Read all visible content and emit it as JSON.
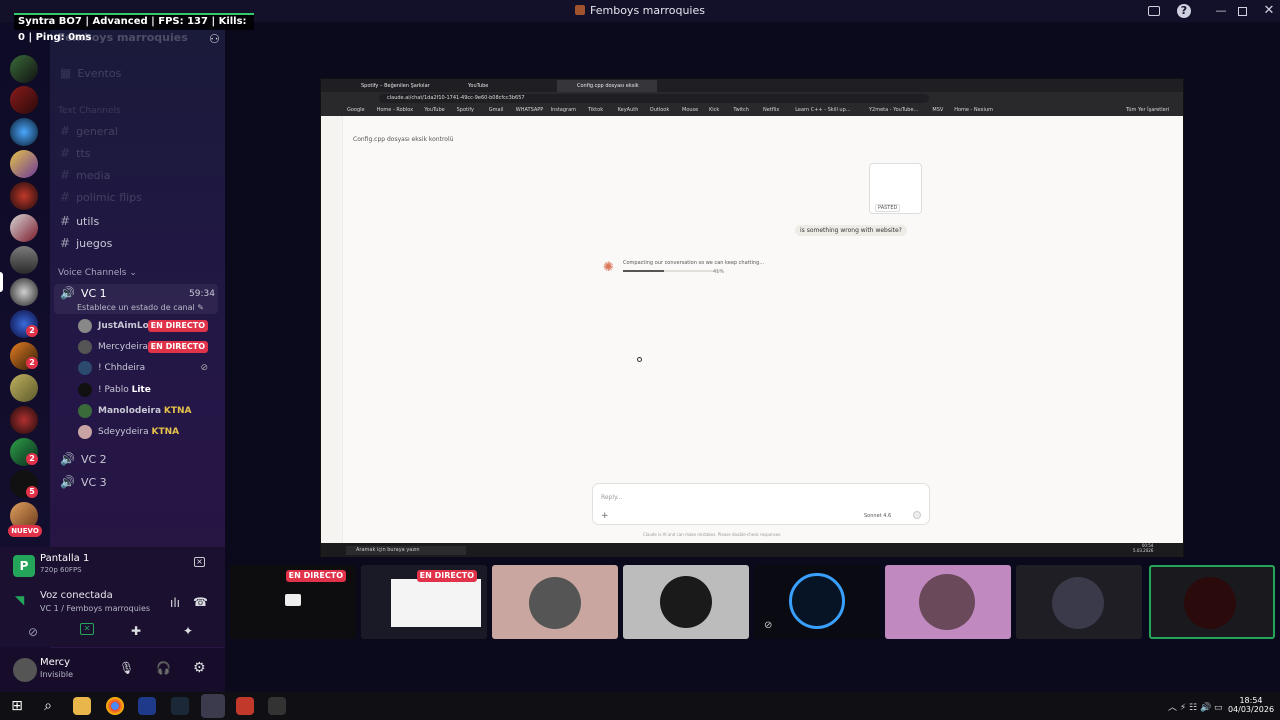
{
  "window": {
    "title": "Femboys marroquies"
  },
  "overlay": {
    "text": "Syntra BO7 | Advanced | FPS: 137 | Kills: 0 | Ping: 0ms"
  },
  "server": {
    "name": "Femboys marroquies"
  },
  "channels_faded": {
    "events": "Eventos",
    "text_cat": "Text Channels",
    "items": [
      "general",
      "tts",
      "media",
      "polimic flips"
    ]
  },
  "channels": {
    "text": [
      "utils",
      "juegos"
    ],
    "voice_cat": "Voice Channels",
    "vc1": "VC 1",
    "vc1_time": "59:34",
    "vc1_status": "Establece un estado de canal",
    "vc2": "VC 2",
    "vc3": "VC 3"
  },
  "voice_users": [
    {
      "name": "JustAimLock",
      "tag": "EN DIRECTO"
    },
    {
      "name": "Mercydeira",
      "tag": "EN DIRECTO"
    },
    {
      "name": "! Chhdeira",
      "tag": ""
    },
    {
      "name": "! Pablo",
      "tag": "Lite"
    },
    {
      "name": "Manolodeira",
      "tag": "KTNA"
    },
    {
      "name": "Sdeyydeira",
      "tag": "KTNA"
    }
  ],
  "server_badges": [
    "2",
    "2",
    "2",
    "5"
  ],
  "nuevo": "NUEVO",
  "screenshare": {
    "title": "Pantalla 1",
    "sub": "720p 60FPS"
  },
  "voice": {
    "status": "Voz conectada",
    "channel": "VC 1 / Femboys marroquies"
  },
  "user": {
    "name": "Mercy",
    "status": "Invisible"
  },
  "browser": {
    "tabs": [
      "Spotify – Beğenilen Şarkılar",
      "YouTube",
      "Config.cpp dosyası eksik kontr..."
    ],
    "url": "claude.ai/chat/1da2f10-1741-49cc-9e60-b08cfcc3b657",
    "bookmarks": [
      "Google",
      "Home - Roblox",
      "YouTube",
      "Spotify",
      "Gmail",
      "WHATSAPP",
      "Instagram",
      "Tiktok",
      "KeyAuth",
      "Outlook",
      "Mouse",
      "Kick",
      "Twitch",
      "Netflix",
      "Learn C++ - Skill up...",
      "Y2meta - YouTube...",
      "MSV",
      "Home - Nexium",
      "Tüm Yer İşaretleri"
    ],
    "chat_title": "Config.cpp dosyası eksik kontrolü",
    "pasted_label": "PASTED",
    "message": "is something wrong with website?",
    "compacting": "Compacting our conversation so we can keep chatting...",
    "progress_pct": "41%",
    "progress": 0.41,
    "reply_placeholder": "Reply...",
    "model": "Sonnet 4.6",
    "disclaimer": "Claude is AI and can make mistakes. Please double-check responses.",
    "search": "Aramak için buraya yazın",
    "clock_time": "00:54",
    "clock_date": "5.03.2026"
  },
  "stream_tiles": [
    {
      "tag": "EN DIRECTO"
    },
    {
      "tag": "EN DIRECTO"
    }
  ],
  "taskbar": {
    "time": "18:54",
    "date": "04/03/2026"
  },
  "colors": {
    "live": "#e0334a",
    "accent": "#5865f2",
    "green": "#23a55a",
    "claude": "#d97757"
  }
}
